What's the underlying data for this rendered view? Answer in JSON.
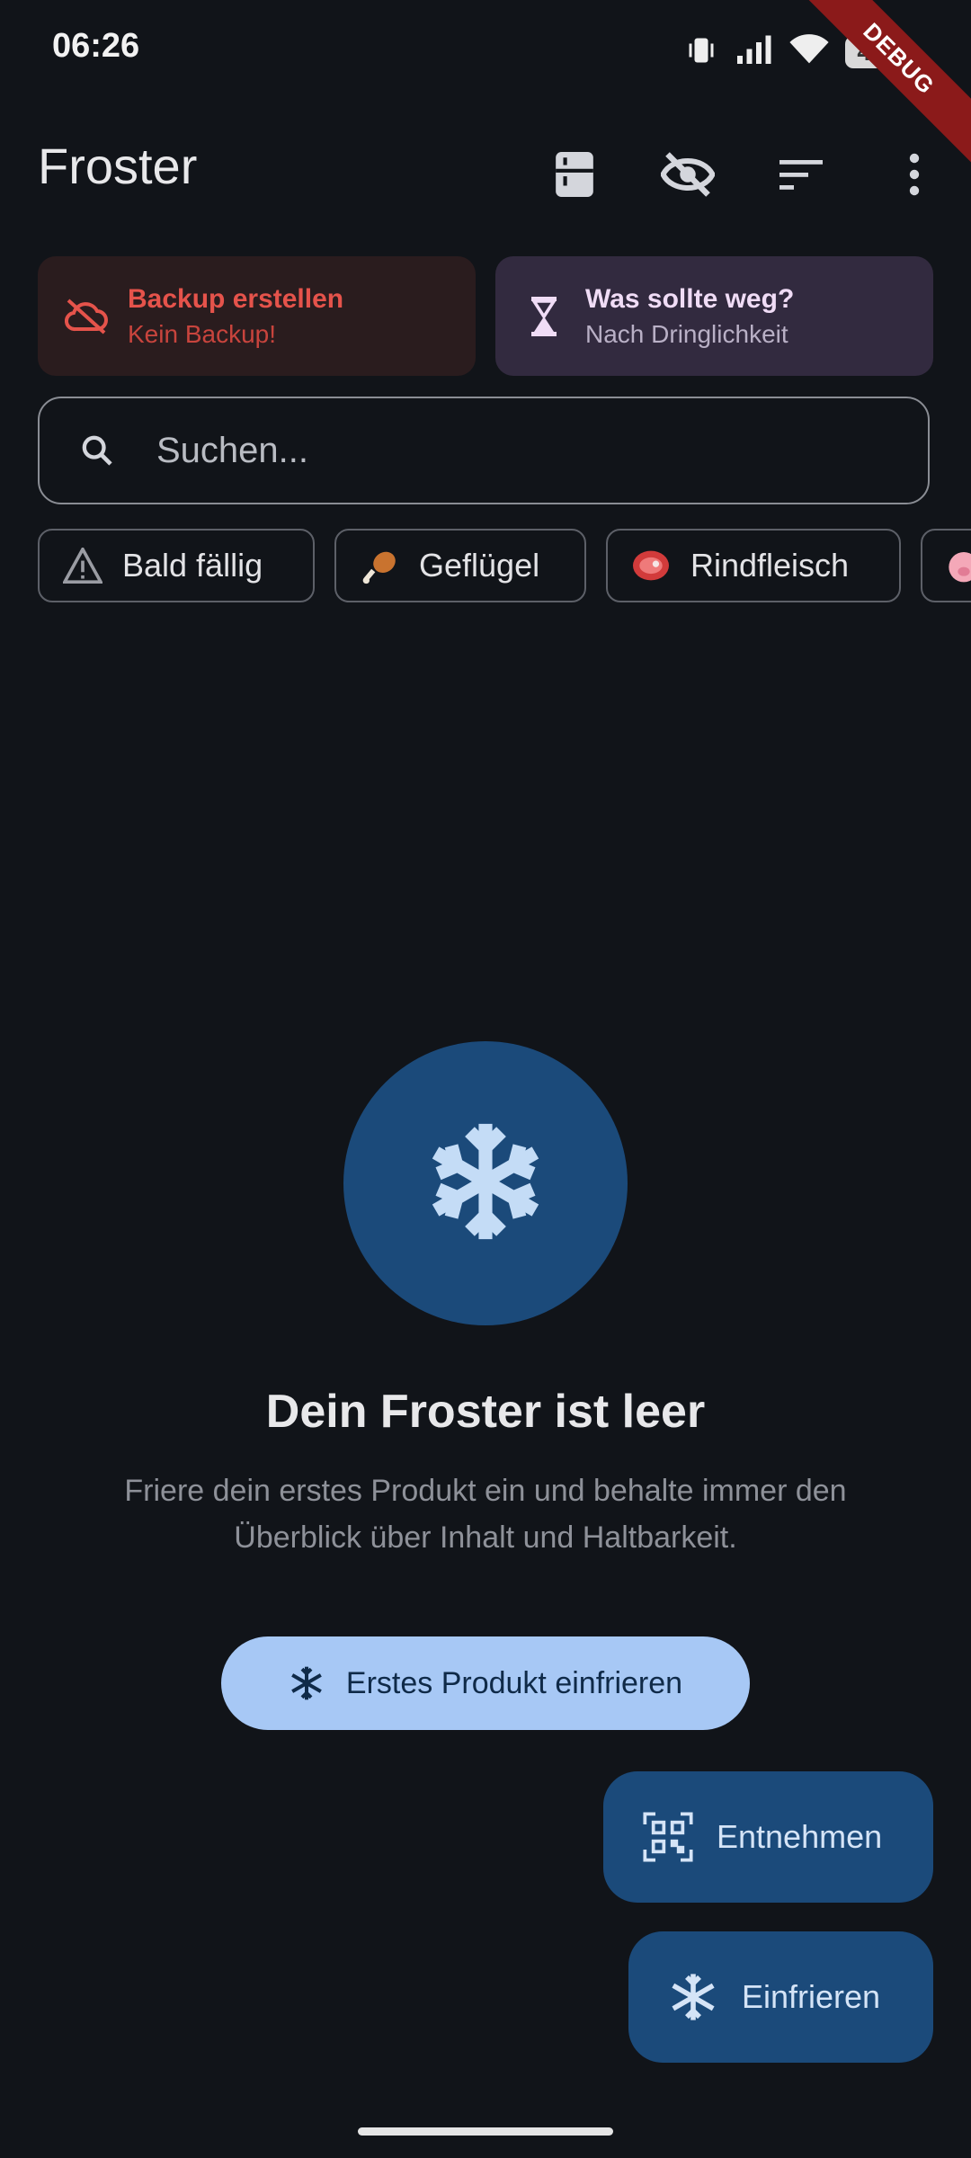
{
  "status_bar": {
    "time": "06:26",
    "battery": "43"
  },
  "debug_banner": "DEBUG",
  "app_bar": {
    "title": "Froster",
    "actions": [
      "fridge-icon",
      "visibility-off-icon",
      "sort-icon",
      "more-vert-icon"
    ]
  },
  "cards": {
    "backup": {
      "title": "Backup erstellen",
      "subtitle": "Kein Backup!",
      "color": "#e5534b",
      "bg": "#2a1c1e"
    },
    "discard": {
      "title": "Was sollte weg?",
      "subtitle": "Nach Dringlichkeit",
      "color": "#f0dcf6",
      "bg": "#322a3f"
    }
  },
  "search": {
    "placeholder": "Suchen..."
  },
  "chips": [
    {
      "label": "Bald fällig",
      "icon": "warning-icon"
    },
    {
      "label": "Geflügel",
      "icon": "poultry-leg-icon"
    },
    {
      "label": "Rindfleisch",
      "icon": "cut-of-meat-icon"
    },
    {
      "label": "",
      "icon": "pig-icon"
    }
  ],
  "empty_state": {
    "title": "Dein Froster ist leer",
    "body": "Friere dein erstes Produkt ein und behalte immer den Überblick über Inhalt und Haltbarkeit.",
    "button_label": "Erstes Produkt einfrieren"
  },
  "fabs": {
    "take_out": "Entnehmen",
    "freeze": "Einfrieren"
  },
  "colors": {
    "background": "#111419",
    "accent": "#1b4a7a",
    "primary_button": "#a7c8f5"
  }
}
